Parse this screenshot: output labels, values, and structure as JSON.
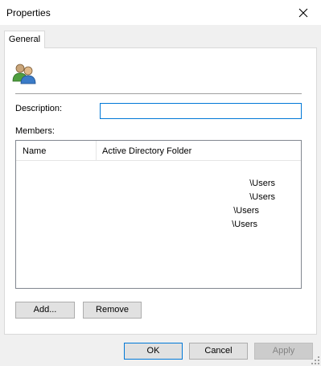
{
  "window": {
    "title": "Properties",
    "close_glyph": "✕"
  },
  "tabs": [
    {
      "label": "General"
    }
  ],
  "group": {
    "icon": "group-icon",
    "name": ""
  },
  "fields": {
    "description_label": "Description:",
    "description_value": "",
    "members_label": "Members:"
  },
  "members_table": {
    "columns": [
      "Name",
      "Active Directory Folder"
    ],
    "rows": [
      {
        "name": "",
        "folder": ""
      },
      {
        "name": "",
        "folder": "\\Users"
      },
      {
        "name": "",
        "folder": "\\Users"
      },
      {
        "name": "",
        "folder": "\\Users"
      },
      {
        "name": "",
        "folder": "\\Users"
      }
    ]
  },
  "buttons": {
    "add": "Add...",
    "remove": "Remove",
    "ok": "OK",
    "cancel": "Cancel",
    "apply": "Apply"
  }
}
